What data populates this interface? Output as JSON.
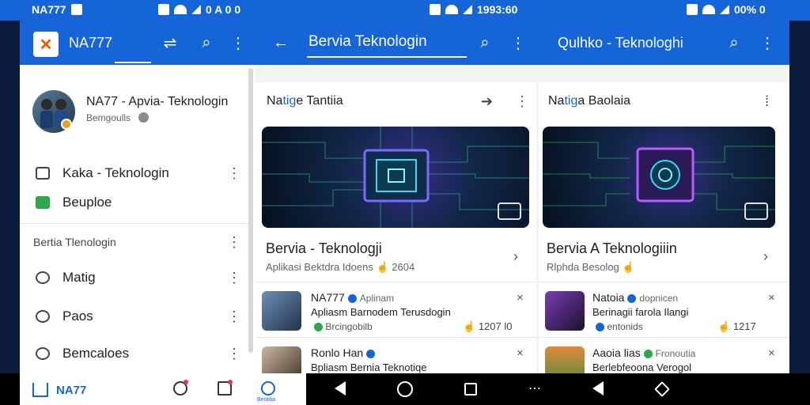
{
  "status_bar": {
    "left_label": "NA777",
    "mid_time": "1993:60",
    "mid_left_time": "0 A 0 0",
    "right_battery": "00% 0"
  },
  "appbar": {
    "app_name": "NA777",
    "search_title": "Bervia Teknologin",
    "right_title": "Qulhko - Teknologhi"
  },
  "drawer": {
    "profile_name": "NA77 - Apvia- Teknologin",
    "profile_sub": "Bemgoulls",
    "items": [
      {
        "label": "Kaka - Teknologin"
      },
      {
        "label": "Beuploe"
      }
    ],
    "section_label": "Bertia Tlenologin",
    "section_items": [
      {
        "label": "Matig"
      },
      {
        "label": "Paos"
      },
      {
        "label": "Bemcaloes"
      }
    ]
  },
  "cards": [
    {
      "head_a": "Na",
      "head_b": "tig",
      "head_c": "e Tantiia",
      "title": "Bervia - Teknologji",
      "meta": "Aplikasi Bektdra Idoens",
      "meta_count": "2604",
      "feed": [
        {
          "name": "NA777",
          "tag": "Aplinam",
          "line": "Apliasm Barnodem Terusdogin",
          "sub": "Brcingobilb",
          "count": "1207 l0"
        },
        {
          "name": "Ronlo Han",
          "tag": "",
          "line": "Bpliasm Bernia Teknotiqe",
          "sub": "",
          "count": ""
        }
      ]
    },
    {
      "head_a": "Na",
      "head_b": "tig",
      "head_c": "a Baolaia",
      "title": "Bervia A Teknologiiin",
      "meta": "Rlphda Besolog",
      "meta_count": "",
      "feed": [
        {
          "name": "Natoia",
          "tag": "dopnicen",
          "line": "Berinagii farola Ilangi",
          "sub": "entonids",
          "count": "1217"
        },
        {
          "name": "Aaoia lias",
          "tag": "Fronoutia",
          "line": "Berlebfeoona Verogol",
          "sub": "",
          "count": ""
        }
      ]
    }
  ],
  "bottom_nav": {
    "home_label": "NA77",
    "active_label": "Bentilia"
  },
  "colors": {
    "accent": "#1565d8",
    "surface": "#ffffff",
    "background": "#f1f3f4"
  }
}
